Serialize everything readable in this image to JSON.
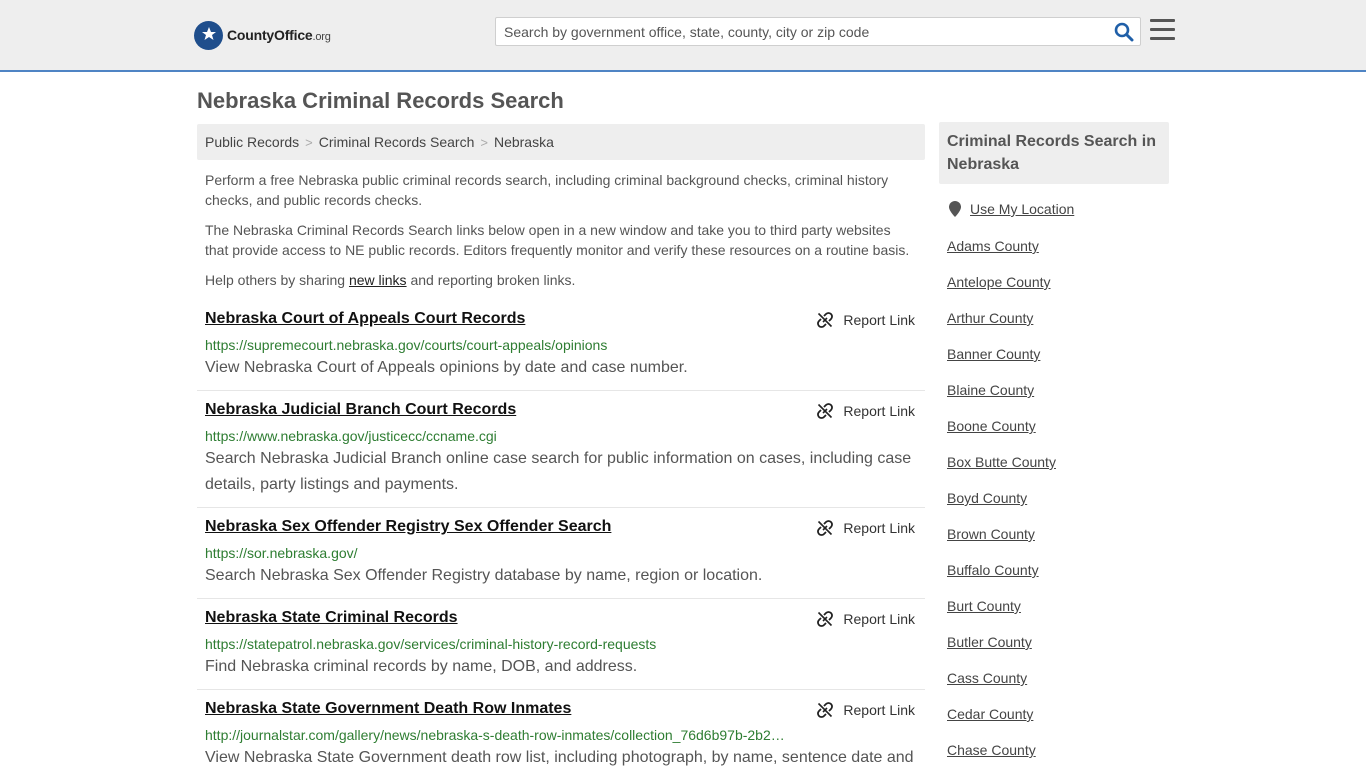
{
  "header": {
    "logo_text_main": "CountyOffice",
    "logo_text_tld": ".org",
    "search_placeholder": "Search by government office, state, county, city or zip code"
  },
  "page_title": "Nebraska Criminal Records Search",
  "breadcrumb": {
    "items": [
      "Public Records",
      "Criminal Records Search",
      "Nebraska"
    ],
    "separator": ">"
  },
  "intro": {
    "p1": "Perform a free Nebraska public criminal records search, including criminal background checks, criminal history checks, and public records checks.",
    "p2": "The Nebraska Criminal Records Search links below open in a new window and take you to third party websites that provide access to NE public records. Editors frequently monitor and verify these resources on a routine basis.",
    "p3_before": "Help others by sharing ",
    "p3_link": "new links",
    "p3_after": " and reporting broken links."
  },
  "report_label": "Report Link",
  "records": [
    {
      "title": "Nebraska Court of Appeals Court Records",
      "url": "https://supremecourt.nebraska.gov/courts/court-appeals/opinions",
      "desc": "View Nebraska Court of Appeals opinions by date and case number."
    },
    {
      "title": "Nebraska Judicial Branch Court Records",
      "url": "https://www.nebraska.gov/justicecc/ccname.cgi",
      "desc": "Search Nebraska Judicial Branch online case search for public information on cases, including case details, party listings and payments."
    },
    {
      "title": "Nebraska Sex Offender Registry Sex Offender Search",
      "url": "https://sor.nebraska.gov/",
      "desc": "Search Nebraska Sex Offender Registry database by name, region or location."
    },
    {
      "title": "Nebraska State Criminal Records",
      "url": "https://statepatrol.nebraska.gov/services/criminal-history-record-requests",
      "desc": "Find Nebraska criminal records by name, DOB, and address."
    },
    {
      "title": "Nebraska State Government Death Row Inmates",
      "url": "http://journalstar.com/gallery/news/nebraska-s-death-row-inmates/collection_76d6b97b-2b2…",
      "desc": "View Nebraska State Government death row list, including photograph, by name, sentence date and"
    }
  ],
  "sidebar": {
    "heading": "Criminal Records Search in Nebraska",
    "use_location": "Use My Location",
    "counties": [
      "Adams County",
      "Antelope County",
      "Arthur County",
      "Banner County",
      "Blaine County",
      "Boone County",
      "Box Butte County",
      "Boyd County",
      "Brown County",
      "Buffalo County",
      "Burt County",
      "Butler County",
      "Cass County",
      "Cedar County",
      "Chase County"
    ]
  },
  "colors": {
    "accent_blue": "#4f84c4",
    "url_green": "#2e7d32",
    "panel_gray": "#eeeeee"
  }
}
